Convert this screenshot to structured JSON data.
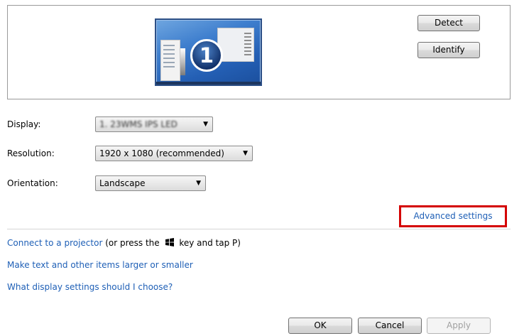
{
  "preview": {
    "monitor_number": "1",
    "detect_label": "Detect",
    "identify_label": "Identify"
  },
  "settings": {
    "display_label": "Display:",
    "display_value": "1. 23WMS IPS LED",
    "resolution_label": "Resolution:",
    "resolution_value": "1920 x 1080 (recommended)",
    "orientation_label": "Orientation:",
    "orientation_value": "Landscape",
    "advanced_link": "Advanced settings"
  },
  "links": {
    "projector_link": "Connect to a projector",
    "projector_text_pre": "(or press the",
    "projector_text_post": "key and tap P)",
    "text_size_link": "Make text and other items larger or smaller",
    "help_link": "What display settings should I choose?"
  },
  "footer": {
    "ok_label": "OK",
    "cancel_label": "Cancel",
    "apply_label": "Apply"
  },
  "colors": {
    "link": "#1e5fb6",
    "highlight": "#d40000"
  },
  "icons": {
    "dropdown": "chevron-down-icon",
    "windows_key": "windows-logo-icon"
  }
}
